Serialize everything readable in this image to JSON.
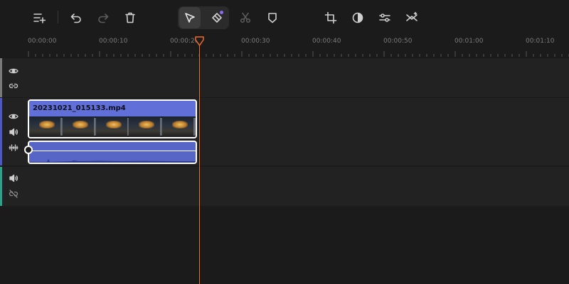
{
  "toolbar": {
    "buttons": [
      {
        "name": "add-track-button",
        "icon": "add-track-icon",
        "enabled": true
      },
      {
        "name": "undo-button",
        "icon": "undo-icon",
        "enabled": true
      },
      {
        "name": "redo-button",
        "icon": "redo-icon",
        "enabled": false
      },
      {
        "name": "delete-button",
        "icon": "trash-icon",
        "enabled": true
      },
      {
        "name": "select-tool-button",
        "icon": "cursor-arrow-icon",
        "enabled": true,
        "active": true
      },
      {
        "name": "blade-tool-button",
        "icon": "tag-icon",
        "enabled": true
      },
      {
        "name": "split-button",
        "icon": "scissors-icon",
        "enabled": false
      },
      {
        "name": "marker-button",
        "icon": "shield-marker-icon",
        "enabled": true
      },
      {
        "name": "crop-button",
        "icon": "crop-icon",
        "enabled": true
      },
      {
        "name": "color-button",
        "icon": "contrast-icon",
        "enabled": true
      },
      {
        "name": "adjust-button",
        "icon": "sliders-icon",
        "enabled": true
      },
      {
        "name": "ai-effects-button",
        "icon": "magic-link-icon",
        "enabled": true
      }
    ]
  },
  "ruler": {
    "labels": [
      "00:00:00",
      "00:00:10",
      "00:00:20",
      "00:00:30",
      "00:00:40",
      "00:00:50",
      "00:01:00",
      "00:01:10"
    ]
  },
  "tracks": [
    {
      "name": "overlay-track",
      "color": "#7a7a7a",
      "icons": [
        "eye-icon",
        "link-icon"
      ]
    },
    {
      "name": "main-video-track",
      "color": "#4c58c8",
      "icons": [
        "eye-icon",
        "speaker-icon",
        "audio-wave-icon"
      ]
    },
    {
      "name": "audio-track",
      "color": "#2aa38a",
      "icons": [
        "speaker-icon",
        "link-off-icon"
      ]
    }
  ],
  "clip": {
    "filename": "20231021_015133.mp4",
    "thumbnail_count": 5
  },
  "colors": {
    "playhead": "#ef6c2a",
    "clip": "#6170d8",
    "audio_clip": "#5665c6"
  }
}
